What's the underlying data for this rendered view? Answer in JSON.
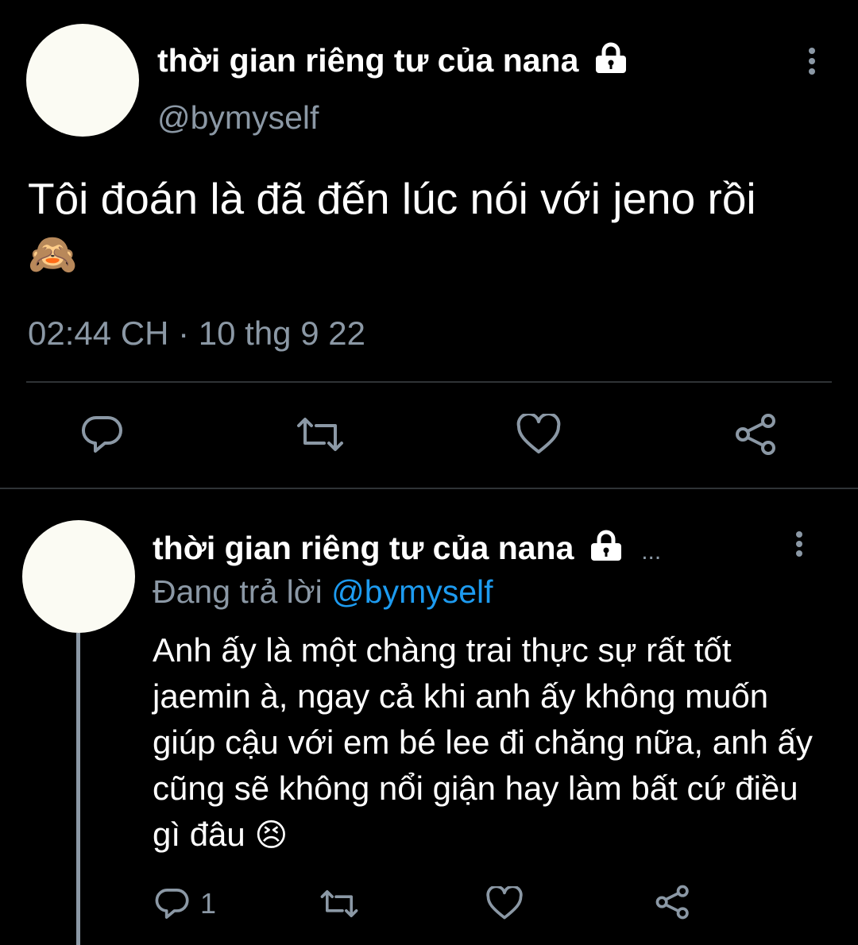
{
  "main_tweet": {
    "display_name": "thời gian riêng tư của nana",
    "handle": "@bymyself",
    "text": "Tôi đoán là đã đến lúc nói với jeno rồi",
    "emoji": "🙈",
    "timestamp": "02:44 CH · 10 thg 9 22",
    "icons": [
      "reply-icon",
      "retweet-icon",
      "like-icon",
      "share-icon"
    ]
  },
  "reply_tweet": {
    "display_name": "thời gian riêng tư của nana",
    "ellipsis": "...",
    "replying_prefix": "Đang trả lời",
    "replying_handle": "@bymyself",
    "text": "Anh ấy là một chàng trai thực sự rất tốt jaemin à, ngay cả khi anh ấy không muốn giúp cậu với em bé lee đi chăng nữa, anh ấy cũng sẽ không nổi giận hay làm bất cứ điều gì đâu",
    "emoji": "😣",
    "reply_count": "1",
    "icons": [
      "reply-icon",
      "retweet-icon",
      "like-icon",
      "share-icon"
    ]
  },
  "colors": {
    "background": "#000000",
    "muted_text": "#8b98a5",
    "link": "#1d9bf0",
    "divider": "#2f3336",
    "avatar": "#fbfbf3"
  }
}
